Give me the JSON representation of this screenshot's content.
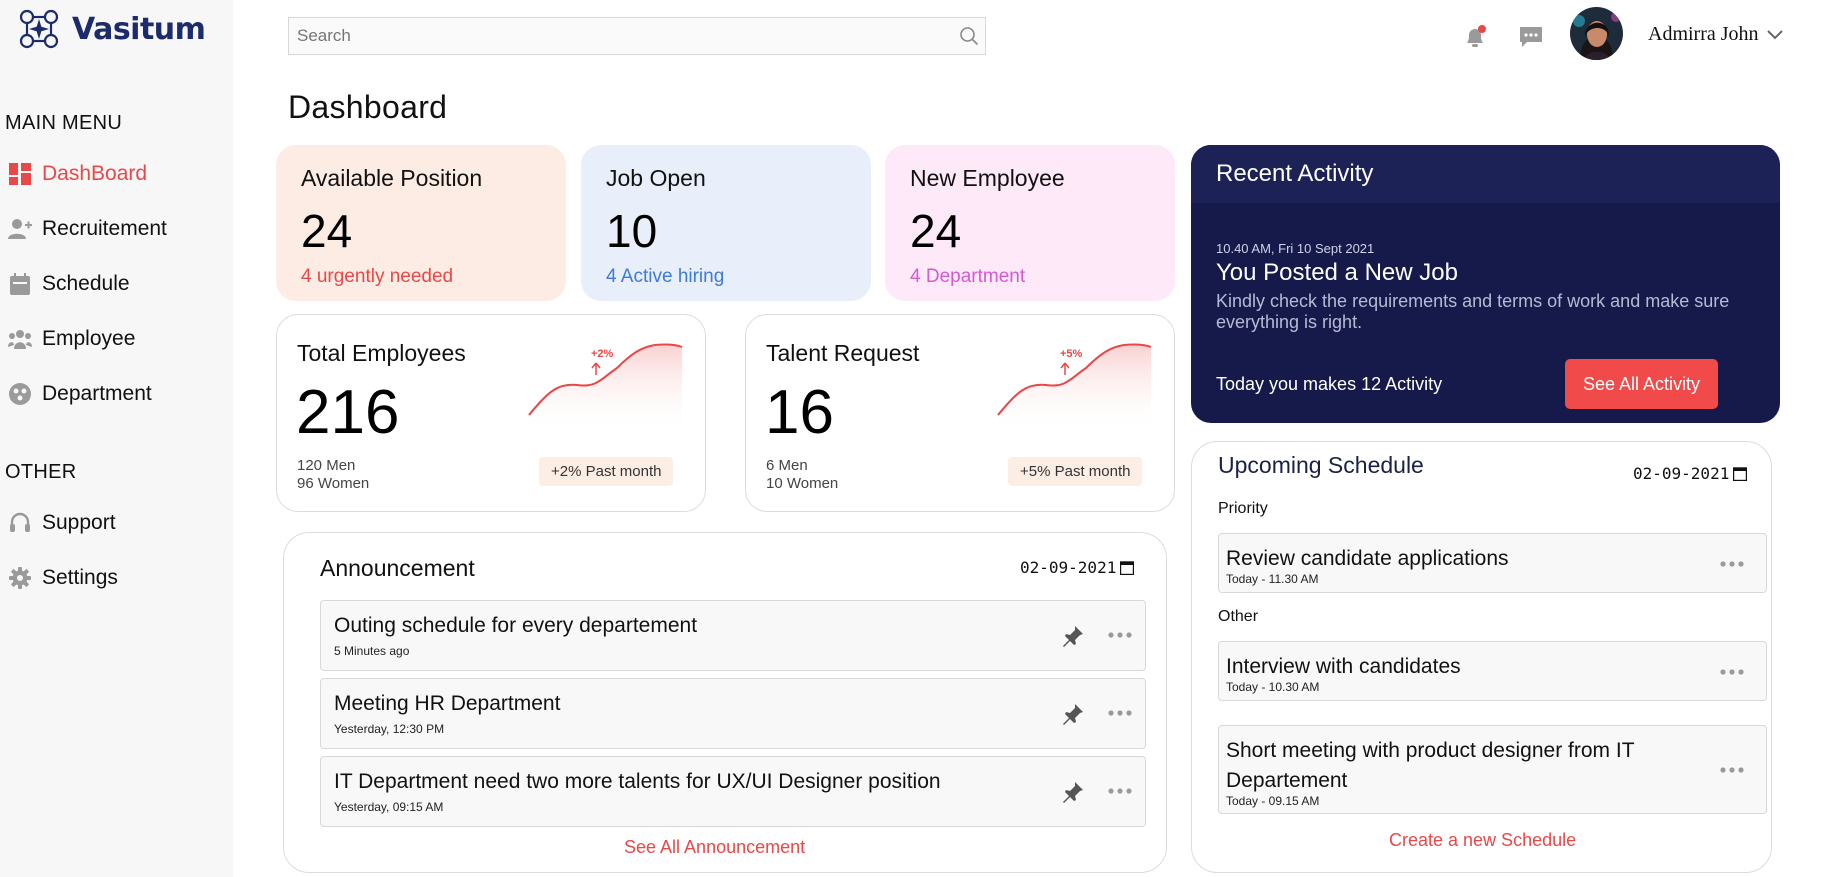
{
  "brand": {
    "name": "Vasitum"
  },
  "sidebar": {
    "main_menu_title": "MAIN MENU",
    "main_items": [
      {
        "label": "DashBoard",
        "icon": "dashboard-icon",
        "active": true
      },
      {
        "label": "Recruitement",
        "icon": "add-user-icon"
      },
      {
        "label": "Schedule",
        "icon": "calendar-icon"
      },
      {
        "label": "Employee",
        "icon": "group-icon"
      },
      {
        "label": "Department",
        "icon": "department-icon"
      }
    ],
    "other_title": "OTHER",
    "other_items": [
      {
        "label": "Support",
        "icon": "headset-icon"
      },
      {
        "label": "Settings",
        "icon": "gear-icon"
      }
    ]
  },
  "header": {
    "search_placeholder": "Search",
    "user_name": "Admirra John"
  },
  "page": {
    "title": "Dashboard"
  },
  "stats": [
    {
      "label": "Available Position",
      "value": "24",
      "sub": "4 urgently needed",
      "bg": "#fdece4",
      "sub_color": "#e94848"
    },
    {
      "label": "Job Open",
      "value": "10",
      "sub": "4 Active hiring",
      "bg": "#e8effa",
      "sub_color": "#3e7bd6"
    },
    {
      "label": "New Employee",
      "value": "24",
      "sub": "4 Department",
      "bg": "#fde9f7",
      "sub_color": "#d45ad1"
    }
  ],
  "metrics": [
    {
      "label": "Total Employees",
      "value": "216",
      "line1": "120 Men",
      "line2": "96 Women",
      "trend": "+2%",
      "badge": "+2% Past month"
    },
    {
      "label": "Talent Request",
      "value": "16",
      "line1": "6 Men",
      "line2": "10 Women",
      "trend": "+5%",
      "badge": "+5% Past month"
    }
  ],
  "activity": {
    "title": "Recent Activity",
    "time": "10.40 AM, Fri 10 Sept 2021",
    "heading": "You Posted a New Job",
    "desc": "Kindly check the requirements and terms of work and make sure everything is right.",
    "count_text": "Today you makes 12 Activity",
    "button": "See All Activity"
  },
  "announcement": {
    "title": "Announcement",
    "date": "02-09-2021",
    "items": [
      {
        "title": "Outing schedule for every departement",
        "time": "5 Minutes ago"
      },
      {
        "title": "Meeting HR Department",
        "time": "Yesterday, 12:30 PM"
      },
      {
        "title": "IT Department need two more talents for UX/UI Designer position",
        "time": "Yesterday, 09:15 AM"
      }
    ],
    "see_all": "See All Announcement"
  },
  "schedule": {
    "title": "Upcoming Schedule",
    "date": "02-09-2021",
    "priority_label": "Priority",
    "other_label": "Other",
    "priority_items": [
      {
        "title": "Review candidate applications",
        "time": "Today - 11.30 AM"
      }
    ],
    "other_items": [
      {
        "title": "Interview with candidates",
        "time": "Today - 10.30 AM"
      },
      {
        "title": "Short meeting with product designer from IT Departement",
        "time": "Today - 09.15 AM"
      }
    ],
    "create": "Create a new Schedule"
  },
  "colors": {
    "accent": "#e94848",
    "navy": "#161a4b",
    "brand_blue": "#1b2b6b"
  }
}
